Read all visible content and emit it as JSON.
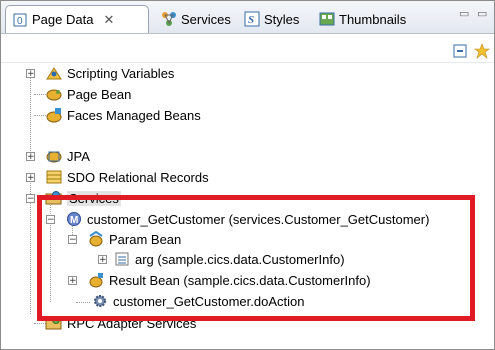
{
  "tabs": [
    {
      "label": "Page Data",
      "active": true,
      "icon": "page-data-icon"
    },
    {
      "label": "Services",
      "active": false,
      "icon": "services-icon"
    },
    {
      "label": "Styles",
      "active": false,
      "icon": "styles-icon"
    },
    {
      "label": "Thumbnails",
      "active": false,
      "icon": "thumbnails-icon"
    }
  ],
  "tab_close_glyph": "✕",
  "toolbar": {
    "collapse_icon": "collapse-all-icon",
    "new_icon": "new-data-icon"
  },
  "tree": {
    "scripting_variables": "Scripting Variables",
    "page_bean": "Page Bean",
    "faces_managed_beans": "Faces Managed Beans",
    "jpa": "JPA",
    "sdo_records": "SDO Relational Records",
    "services": "Services",
    "service_method": "customer_GetCustomer (services.Customer_GetCustomer)",
    "param_bean": "Param Bean",
    "arg": "arg (sample.cics.data.CustomerInfo)",
    "result_bean": "Result Bean (sample.cics.data.CustomerInfo)",
    "action": "customer_GetCustomer.doAction",
    "rpc_adapter": "RPC Adapter Services"
  },
  "colors": {
    "highlight": "#e01b24",
    "selection": "#e3e3e3"
  }
}
